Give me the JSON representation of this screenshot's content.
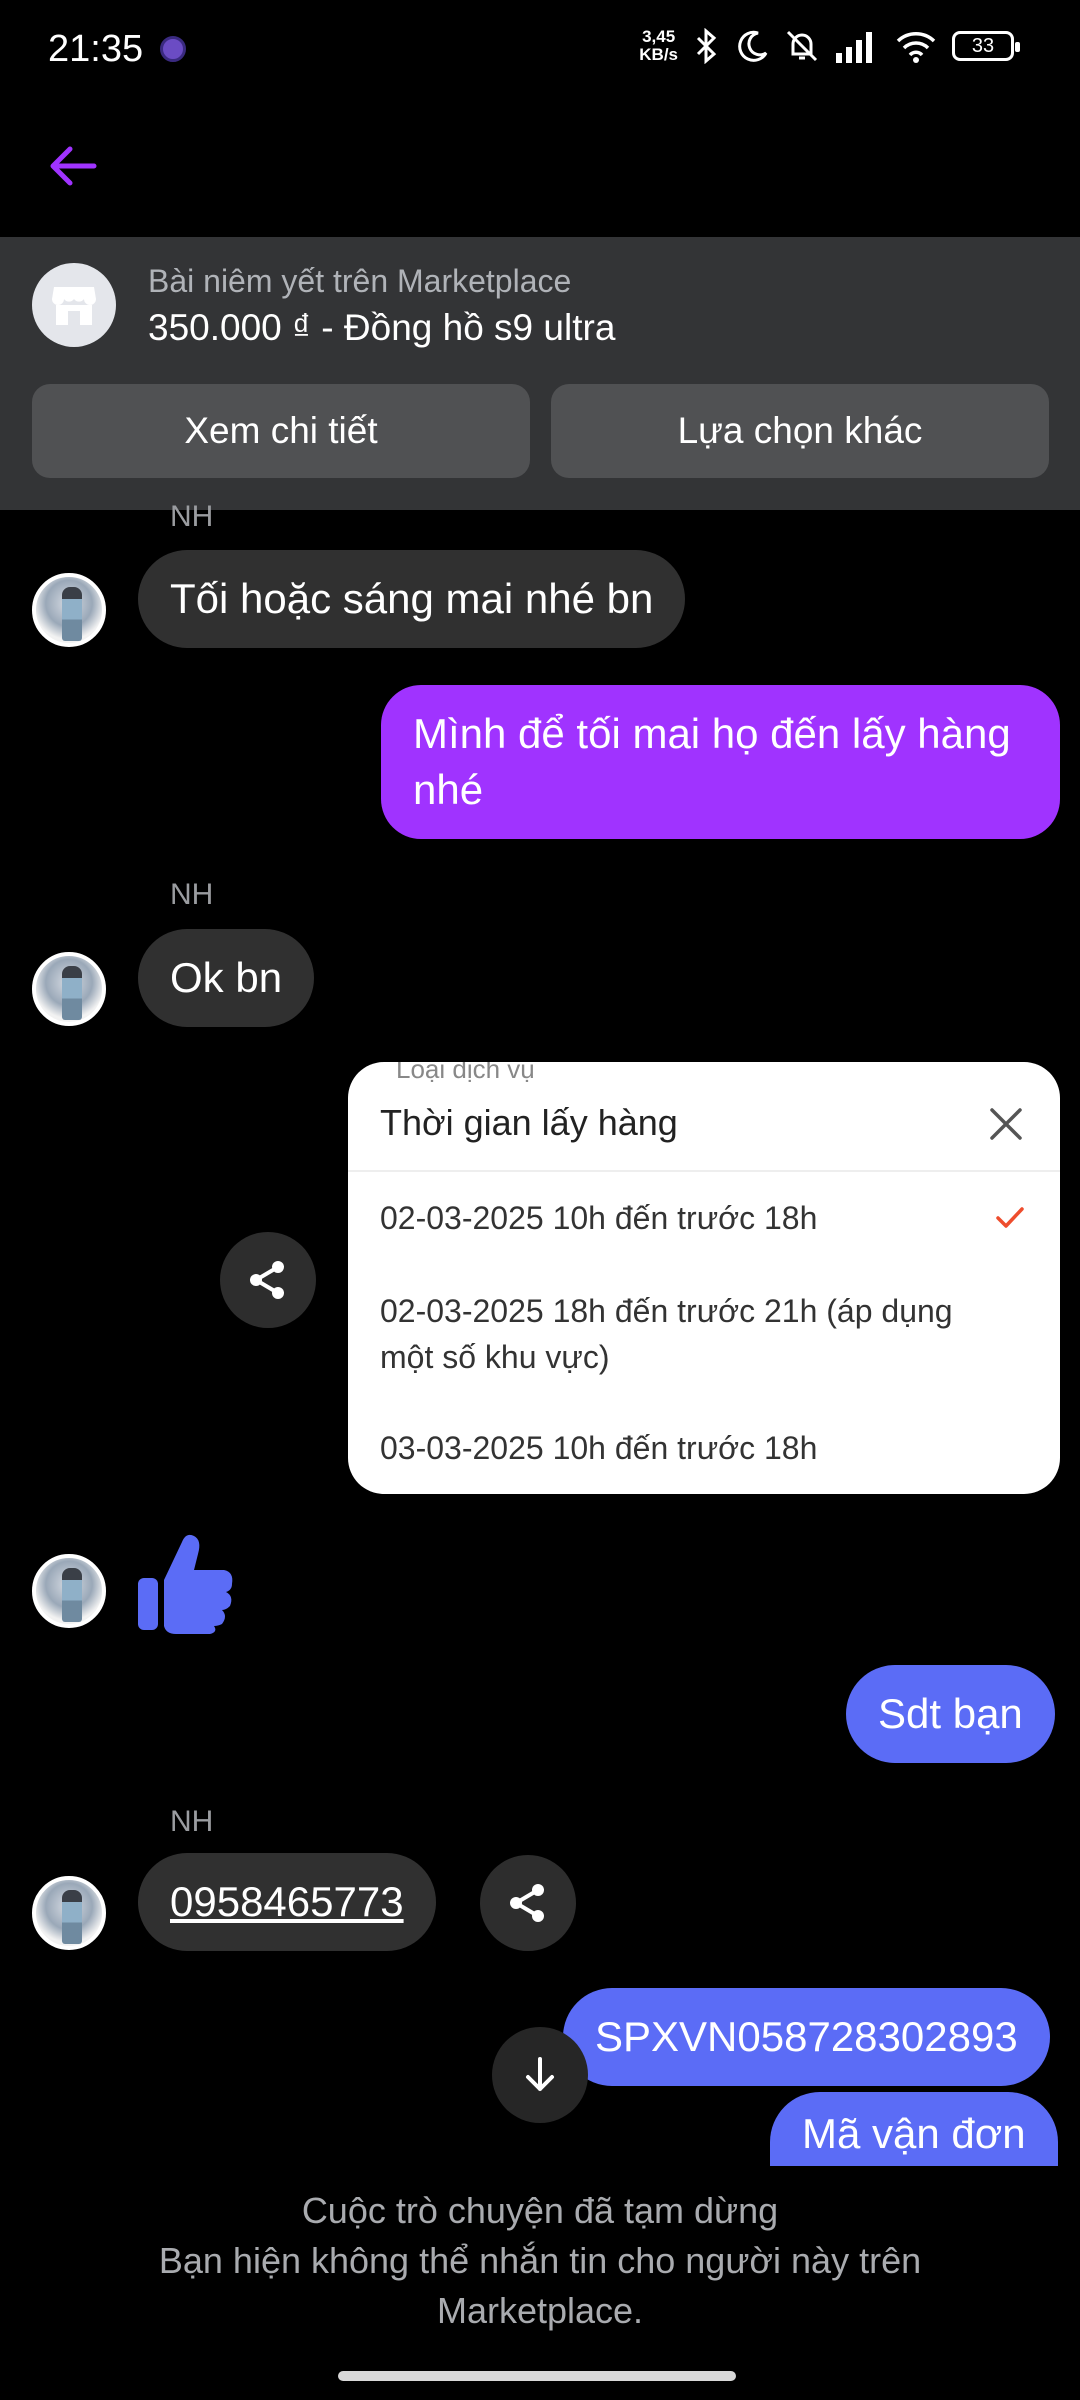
{
  "status_bar": {
    "time": "21:35",
    "speed_value": "3,45",
    "speed_unit": "KB/s",
    "battery": "33"
  },
  "listing": {
    "subtitle": "Bài niêm yết trên Marketplace",
    "title": "350.000 ₫ - Đồng hồ s9 ultra",
    "view_details": "Xem chi tiết",
    "other_options": "Lựa chọn khác"
  },
  "messages": {
    "sender_initials": "NH",
    "m1": "Tối hoặc sáng mai nhé bn",
    "m2": "Mình để tối mai họ đến lấy hàng nhé",
    "m3": "Ok bn",
    "m5": "Sdt bạn",
    "m6": "0958465773",
    "m7": "SPXVN058728302893",
    "m8": "Mã vận đơn"
  },
  "pickup_popup": {
    "peek_text": "Loại dịch vụ",
    "title": "Thời gian lấy hàng",
    "options": [
      "02-03-2025 10h đến trước 18h",
      "02-03-2025 18h đến trước 21h (áp dụng một số khu vực)",
      "03-03-2025 10h đến trước 18h"
    ],
    "selected_index": 0
  },
  "footer": {
    "line1": "Cuộc trò chuyện đã tạm dừng",
    "line2": "Bạn hiện không thể nhắn tin cho người này trên Marketplace."
  },
  "colors": {
    "accent_purple": "#a033ff",
    "bubble_blue": "#5b6cf6",
    "thumb_blue": "#5b6cf6",
    "check_orange": "#ee4d2d"
  }
}
